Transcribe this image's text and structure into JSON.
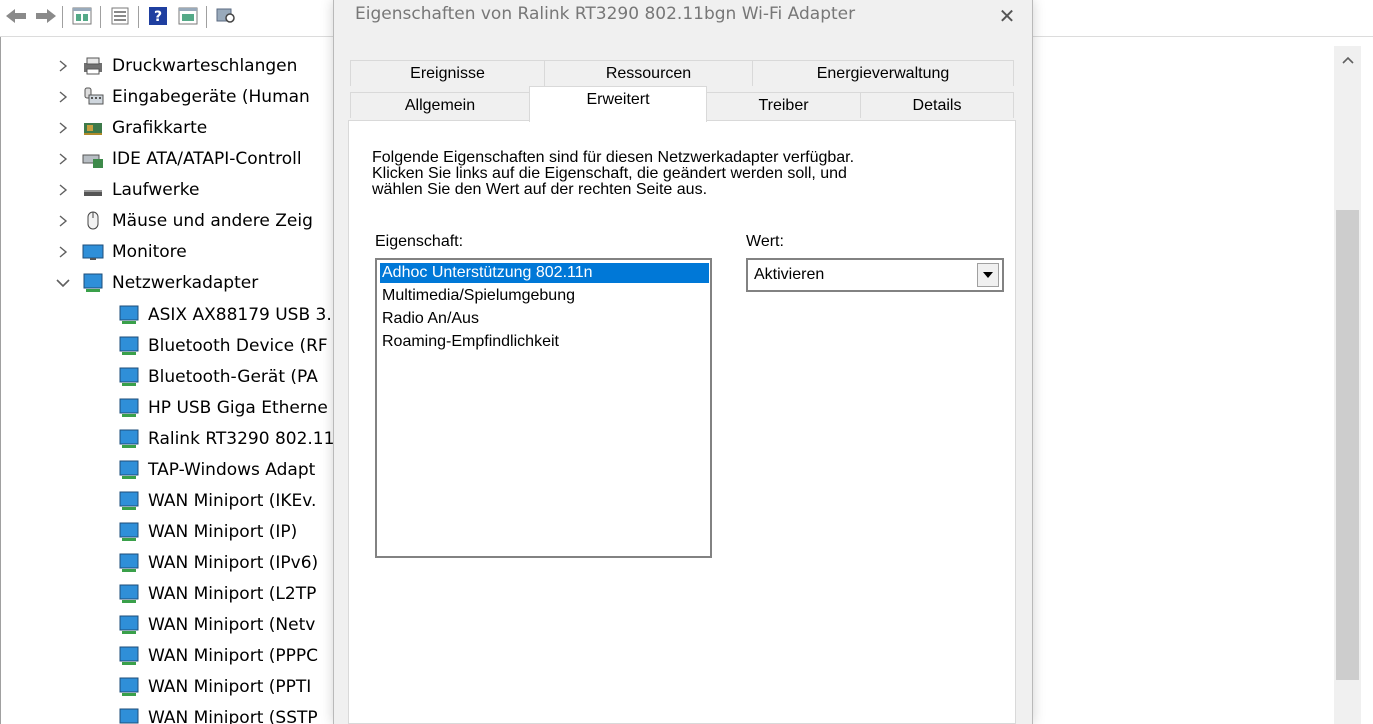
{
  "toolbar": {
    "icons": [
      "back-arrow-icon",
      "forward-arrow-icon",
      "properties-icon",
      "list-icon",
      "help-icon",
      "view-icon",
      "scan-hardware-icon"
    ]
  },
  "tree": {
    "categories": [
      {
        "label": "Druckwarteschlangen",
        "icon": "printer-icon",
        "expanded": false
      },
      {
        "label": "Eingabegeräte (Human",
        "icon": "keyboard-icon",
        "expanded": false
      },
      {
        "label": "Grafikkarte",
        "icon": "graphics-card-icon",
        "expanded": false
      },
      {
        "label": "IDE ATA/ATAPI-Controll",
        "icon": "disk-controller-icon",
        "expanded": false
      },
      {
        "label": "Laufwerke",
        "icon": "drive-icon",
        "expanded": false
      },
      {
        "label": "Mäuse und andere Zeig",
        "icon": "mouse-icon",
        "expanded": false
      },
      {
        "label": "Monitore",
        "icon": "monitor-icon",
        "expanded": false
      },
      {
        "label": "Netzwerkadapter",
        "icon": "network-adapter-icon",
        "expanded": true
      }
    ],
    "adapters": [
      "ASIX AX88179 USB 3.",
      "Bluetooth Device (RF",
      "Bluetooth-Gerät (PA",
      "HP USB Giga Etherne",
      "Ralink RT3290 802.11",
      "TAP-Windows Adapt",
      "WAN Miniport (IKEv.",
      "WAN Miniport (IP)",
      "WAN Miniport (IPv6)",
      "WAN Miniport (L2TP",
      "WAN Miniport (Netv",
      "WAN Miniport (PPPC",
      "WAN Miniport (PPTI",
      "WAN Miniport (SSTP"
    ]
  },
  "dialog": {
    "title": "Eigenschaften von Ralink RT3290 802.11bgn Wi-Fi Adapter",
    "close_symbol": "✕",
    "tabs_row1": [
      "Ereignisse",
      "Ressourcen",
      "Energieverwaltung"
    ],
    "tabs_row2": [
      "Allgemein",
      "Erweitert",
      "Treiber",
      "Details"
    ],
    "active_tab": "Erweitert",
    "description": [
      "Folgende Eigenschaften sind für diesen Netzwerkadapter verfügbar.",
      "Klicken Sie links auf die Eigenschaft, die geändert werden soll, und",
      "wählen Sie den Wert auf der rechten Seite aus."
    ],
    "property_label": "Eigenschaft:",
    "value_label": "Wert:",
    "properties": [
      "Adhoc Unterstützung 802.11n",
      "Multimedia/Spielumgebung",
      "Radio An/Aus",
      "Roaming-Empfindlichkeit"
    ],
    "selected_property": "Adhoc Unterstützung 802.11n",
    "value": "Aktivieren"
  },
  "colors": {
    "selection": "#0078d7",
    "dialog_bg": "#f0f0f0",
    "adapter_icon": "#2f8fd8"
  }
}
